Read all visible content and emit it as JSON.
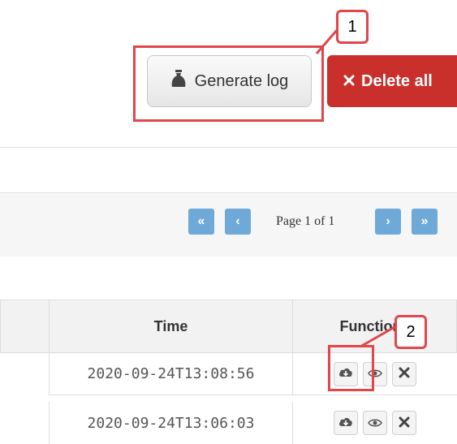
{
  "toolbar": {
    "generate_label": "Generate log",
    "delete_label": "Delete all"
  },
  "callouts": [
    "1",
    "2"
  ],
  "pagination": {
    "first_label": "«",
    "prev_label": "‹",
    "page_text": "Page 1 of 1",
    "next_label": "›",
    "last_label": "»"
  },
  "table": {
    "headers": {
      "time": "Time",
      "functions": "Functions"
    },
    "rows": [
      {
        "time": "2020-09-24T13:08:56"
      },
      {
        "time": "2020-09-24T13:06:03"
      }
    ]
  },
  "icons": {
    "generate": "money-bag-icon",
    "delete": "times-icon",
    "download": "cloud-download-icon",
    "view": "eye-icon",
    "remove": "times-icon"
  },
  "colors": {
    "danger": "#c9302c",
    "pager": "#6ea9d8",
    "highlight": "#e0464a"
  }
}
